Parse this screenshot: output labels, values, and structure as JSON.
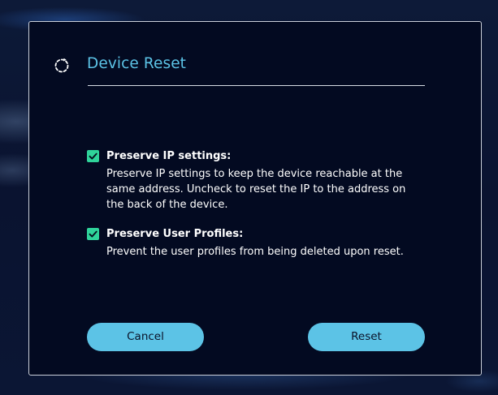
{
  "dialog": {
    "title": "Device Reset",
    "icon": "reset-icon",
    "accent_color": "#5cc3e6",
    "check_color": "#2fd39a"
  },
  "options": [
    {
      "label": "Preserve IP settings:",
      "checked": true,
      "description": "Preserve IP settings to keep the device reachable at the same address. Uncheck to reset the IP to the address on the back of the device."
    },
    {
      "label": "Preserve User Profiles:",
      "checked": true,
      "description": "Prevent the user profiles from being deleted upon reset."
    }
  ],
  "buttons": {
    "cancel_label": "Cancel",
    "reset_label": "Reset"
  }
}
